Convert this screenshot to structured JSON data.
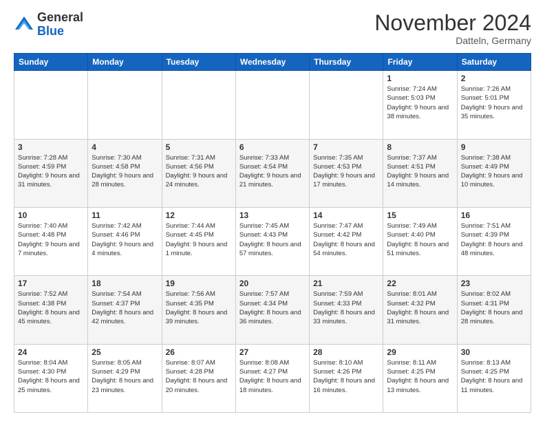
{
  "header": {
    "logo_general": "General",
    "logo_blue": "Blue",
    "month_title": "November 2024",
    "location": "Datteln, Germany"
  },
  "weekdays": [
    "Sunday",
    "Monday",
    "Tuesday",
    "Wednesday",
    "Thursday",
    "Friday",
    "Saturday"
  ],
  "weeks": [
    [
      {
        "day": "",
        "info": ""
      },
      {
        "day": "",
        "info": ""
      },
      {
        "day": "",
        "info": ""
      },
      {
        "day": "",
        "info": ""
      },
      {
        "day": "",
        "info": ""
      },
      {
        "day": "1",
        "info": "Sunrise: 7:24 AM\nSunset: 5:03 PM\nDaylight: 9 hours and 38 minutes."
      },
      {
        "day": "2",
        "info": "Sunrise: 7:26 AM\nSunset: 5:01 PM\nDaylight: 9 hours and 35 minutes."
      }
    ],
    [
      {
        "day": "3",
        "info": "Sunrise: 7:28 AM\nSunset: 4:59 PM\nDaylight: 9 hours and 31 minutes."
      },
      {
        "day": "4",
        "info": "Sunrise: 7:30 AM\nSunset: 4:58 PM\nDaylight: 9 hours and 28 minutes."
      },
      {
        "day": "5",
        "info": "Sunrise: 7:31 AM\nSunset: 4:56 PM\nDaylight: 9 hours and 24 minutes."
      },
      {
        "day": "6",
        "info": "Sunrise: 7:33 AM\nSunset: 4:54 PM\nDaylight: 9 hours and 21 minutes."
      },
      {
        "day": "7",
        "info": "Sunrise: 7:35 AM\nSunset: 4:53 PM\nDaylight: 9 hours and 17 minutes."
      },
      {
        "day": "8",
        "info": "Sunrise: 7:37 AM\nSunset: 4:51 PM\nDaylight: 9 hours and 14 minutes."
      },
      {
        "day": "9",
        "info": "Sunrise: 7:38 AM\nSunset: 4:49 PM\nDaylight: 9 hours and 10 minutes."
      }
    ],
    [
      {
        "day": "10",
        "info": "Sunrise: 7:40 AM\nSunset: 4:48 PM\nDaylight: 9 hours and 7 minutes."
      },
      {
        "day": "11",
        "info": "Sunrise: 7:42 AM\nSunset: 4:46 PM\nDaylight: 9 hours and 4 minutes."
      },
      {
        "day": "12",
        "info": "Sunrise: 7:44 AM\nSunset: 4:45 PM\nDaylight: 9 hours and 1 minute."
      },
      {
        "day": "13",
        "info": "Sunrise: 7:45 AM\nSunset: 4:43 PM\nDaylight: 8 hours and 57 minutes."
      },
      {
        "day": "14",
        "info": "Sunrise: 7:47 AM\nSunset: 4:42 PM\nDaylight: 8 hours and 54 minutes."
      },
      {
        "day": "15",
        "info": "Sunrise: 7:49 AM\nSunset: 4:40 PM\nDaylight: 8 hours and 51 minutes."
      },
      {
        "day": "16",
        "info": "Sunrise: 7:51 AM\nSunset: 4:39 PM\nDaylight: 8 hours and 48 minutes."
      }
    ],
    [
      {
        "day": "17",
        "info": "Sunrise: 7:52 AM\nSunset: 4:38 PM\nDaylight: 8 hours and 45 minutes."
      },
      {
        "day": "18",
        "info": "Sunrise: 7:54 AM\nSunset: 4:37 PM\nDaylight: 8 hours and 42 minutes."
      },
      {
        "day": "19",
        "info": "Sunrise: 7:56 AM\nSunset: 4:35 PM\nDaylight: 8 hours and 39 minutes."
      },
      {
        "day": "20",
        "info": "Sunrise: 7:57 AM\nSunset: 4:34 PM\nDaylight: 8 hours and 36 minutes."
      },
      {
        "day": "21",
        "info": "Sunrise: 7:59 AM\nSunset: 4:33 PM\nDaylight: 8 hours and 33 minutes."
      },
      {
        "day": "22",
        "info": "Sunrise: 8:01 AM\nSunset: 4:32 PM\nDaylight: 8 hours and 31 minutes."
      },
      {
        "day": "23",
        "info": "Sunrise: 8:02 AM\nSunset: 4:31 PM\nDaylight: 8 hours and 28 minutes."
      }
    ],
    [
      {
        "day": "24",
        "info": "Sunrise: 8:04 AM\nSunset: 4:30 PM\nDaylight: 8 hours and 25 minutes."
      },
      {
        "day": "25",
        "info": "Sunrise: 8:05 AM\nSunset: 4:29 PM\nDaylight: 8 hours and 23 minutes."
      },
      {
        "day": "26",
        "info": "Sunrise: 8:07 AM\nSunset: 4:28 PM\nDaylight: 8 hours and 20 minutes."
      },
      {
        "day": "27",
        "info": "Sunrise: 8:08 AM\nSunset: 4:27 PM\nDaylight: 8 hours and 18 minutes."
      },
      {
        "day": "28",
        "info": "Sunrise: 8:10 AM\nSunset: 4:26 PM\nDaylight: 8 hours and 16 minutes."
      },
      {
        "day": "29",
        "info": "Sunrise: 8:11 AM\nSunset: 4:25 PM\nDaylight: 8 hours and 13 minutes."
      },
      {
        "day": "30",
        "info": "Sunrise: 8:13 AM\nSunset: 4:25 PM\nDaylight: 8 hours and 11 minutes."
      }
    ]
  ]
}
